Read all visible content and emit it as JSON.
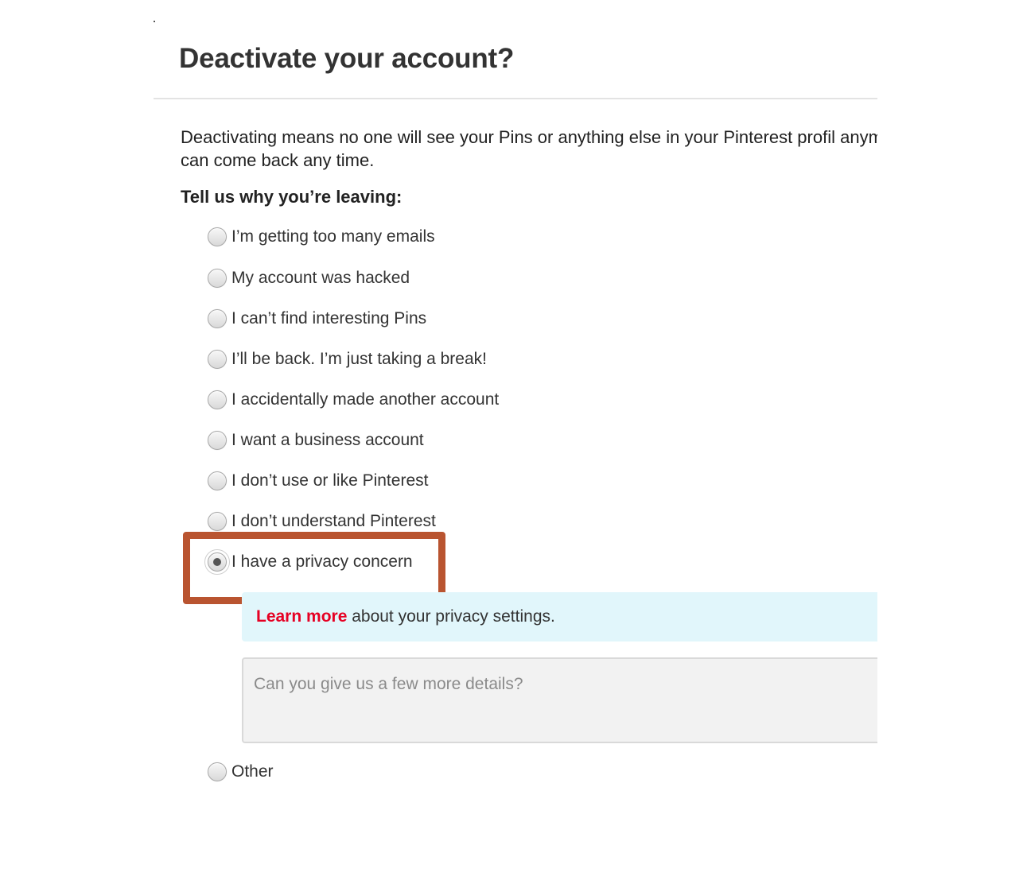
{
  "dialog": {
    "title": "Deactivate your account?",
    "intro": "Deactivating means no one will see your Pins or anything else in your Pinterest profil anymore. You can come back any time.",
    "prompt": "Tell us why you’re leaving:"
  },
  "reasons": [
    {
      "label": "I’m getting too many emails",
      "checked": false
    },
    {
      "label": "My account was hacked",
      "checked": false
    },
    {
      "label": "I can’t find interesting Pins",
      "checked": false
    },
    {
      "label": "I’ll be back. I’m just taking a break!",
      "checked": false
    },
    {
      "label": "I accidentally made another account",
      "checked": false
    },
    {
      "label": "I want a business account",
      "checked": false
    },
    {
      "label": "I don’t use or like Pinterest",
      "checked": false
    },
    {
      "label": "I don’t understand Pinterest",
      "checked": false
    },
    {
      "label": "I have a privacy concern",
      "checked": true
    },
    {
      "label": "Other",
      "checked": false
    }
  ],
  "privacy_info": {
    "link_text": "Learn more",
    "text": " about your privacy settings."
  },
  "details": {
    "placeholder": "Can you give us a few more details?",
    "value": ""
  },
  "colors": {
    "highlight": "#b95430",
    "link": "#e60023",
    "info_background": "#e1f6fb"
  }
}
